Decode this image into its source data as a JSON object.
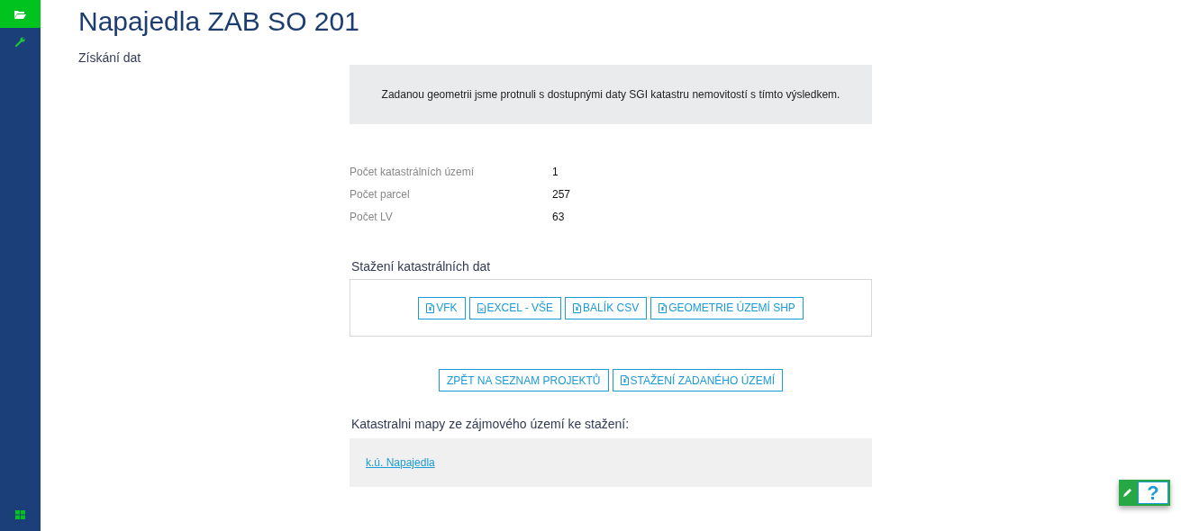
{
  "sidebar": {
    "items": [
      {
        "selected": true
      },
      {
        "selected": false
      }
    ]
  },
  "title": "Napajedla ZAB SO 201",
  "subtitle": "Získání dat",
  "notice": "Zadanou geometrii jsme protnuli s dostupnými daty SGI katastru nemovitostí s tímto výsledkem.",
  "stats": [
    {
      "label": "Počet katastrálních území",
      "value": "1"
    },
    {
      "label": "Počet parcel",
      "value": "257"
    },
    {
      "label": "Počet LV",
      "value": "63"
    }
  ],
  "download": {
    "heading": "Stažení katastrálních dat",
    "buttons": [
      {
        "label": "VFK",
        "kind": "file"
      },
      {
        "label": "EXCEL - VŠE",
        "kind": "excel"
      },
      {
        "label": "BALÍK CSV",
        "kind": "file"
      },
      {
        "label": "GEOMETRIE ÚZEMÍ SHP",
        "kind": "file"
      }
    ]
  },
  "actions": [
    {
      "label": "ZPĚT NA SEZNAM PROJEKTŮ",
      "kind": "plain"
    },
    {
      "label": "STAŽENÍ ZADANÉHO ÚZEMÍ",
      "kind": "file"
    }
  ],
  "maps": {
    "heading": "Katastralni mapy ze zájmového území ke stažení:",
    "links": [
      "k.ú. Napajedla"
    ]
  },
  "help_widget": {
    "label": "?"
  }
}
